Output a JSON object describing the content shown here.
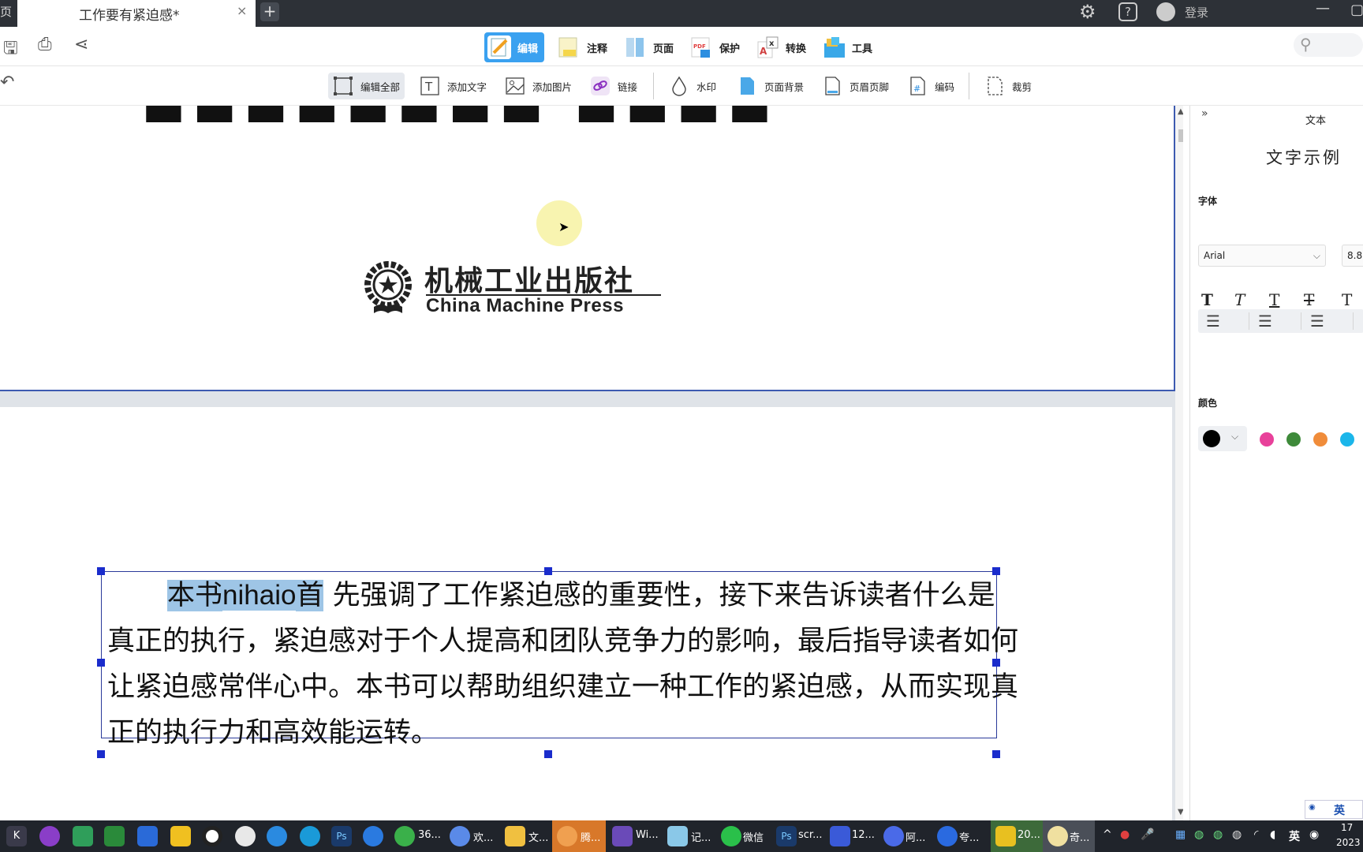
{
  "titlebar": {
    "home_label": "页",
    "tab_title": "工作要有紧迫感*",
    "close_tab": "×",
    "new_tab": "+",
    "login": "登录",
    "help": "?"
  },
  "toolbar": {
    "modes": [
      "编辑",
      "注释",
      "页面",
      "保护",
      "转换",
      "工具"
    ],
    "active_mode": "编辑"
  },
  "subtoolbar": {
    "items": [
      "编辑全部",
      "添加文字",
      "添加图片",
      "链接",
      "水印",
      "页面背景",
      "页眉页脚",
      "编码",
      "裁剪"
    ]
  },
  "document": {
    "publisher_cn": "机械工业出版社",
    "publisher_en": "China Machine Press",
    "paragraph": {
      "selected_prefix": "本书",
      "ime_text": "nihaio",
      "selected_suffix": "首",
      "rest": "先强调了工作紧迫感的重要性，接下来告诉读者什么是真正的执行，紧迫感对于个人提高和团队竞争力的影响，最后指导读者如何让紧迫感常伴心中。本书可以帮助组织建立一种工作的紧迫感，从而实现真正的执行力和高效能运转。"
    }
  },
  "panel": {
    "title": "文本",
    "sample": "文字示例",
    "font_label": "字体",
    "font_name": "Arial",
    "font_size": "8.8",
    "format_buttons": [
      "T",
      "T",
      "T",
      "T",
      "T"
    ],
    "color_label": "颜色",
    "colors": [
      "#000000",
      "#e8419a",
      "#3e8a3a",
      "#f08c3a",
      "#1bb6ea"
    ],
    "ifly": "英"
  },
  "taskbar": {
    "items": [
      "36...",
      "欢...",
      "文...",
      "腾...",
      "Wi...",
      "记...",
      "微信",
      "scr...",
      "12...",
      "阿...",
      "夸...",
      "20...",
      "奇..."
    ],
    "ime": "英",
    "time": "17",
    "date": "2023"
  }
}
